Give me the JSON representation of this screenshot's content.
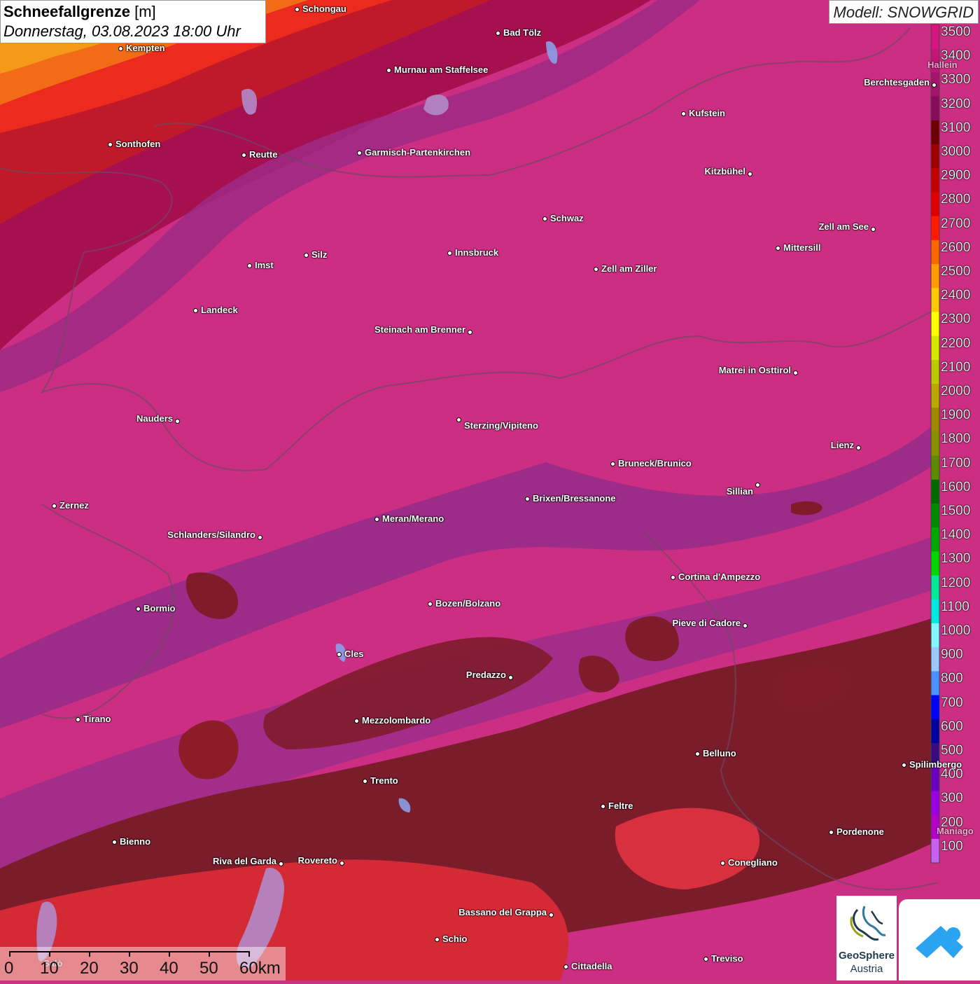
{
  "title": {
    "main": "Schneefallgrenze",
    "unit": "[m]",
    "date": "Donnerstag, 03.08.2023 18:00 Uhr"
  },
  "model": "Modell: SNOWGRID",
  "legend": [
    {
      "label": "3500",
      "color": "#d8127f"
    },
    {
      "label": "3400",
      "color": "#c41478"
    },
    {
      "label": "3300",
      "color": "#a8126e"
    },
    {
      "label": "3200",
      "color": "#8a0a5e"
    },
    {
      "label": "3100",
      "color": "#6e0000"
    },
    {
      "label": "3000",
      "color": "#a00000"
    },
    {
      "label": "2900",
      "color": "#c40000"
    },
    {
      "label": "2800",
      "color": "#e00000"
    },
    {
      "label": "2700",
      "color": "#ff1a00"
    },
    {
      "label": "2600",
      "color": "#ff6600"
    },
    {
      "label": "2500",
      "color": "#ff9a00"
    },
    {
      "label": "2400",
      "color": "#ffc800"
    },
    {
      "label": "2300",
      "color": "#ffff00"
    },
    {
      "label": "2200",
      "color": "#d8e800"
    },
    {
      "label": "2100",
      "color": "#c0c800"
    },
    {
      "label": "2000",
      "color": "#b8a800"
    },
    {
      "label": "1900",
      "color": "#a08800"
    },
    {
      "label": "1800",
      "color": "#889000"
    },
    {
      "label": "1700",
      "color": "#5c8a00"
    },
    {
      "label": "1600",
      "color": "#006a00"
    },
    {
      "label": "1500",
      "color": "#008a00"
    },
    {
      "label": "1400",
      "color": "#00a800"
    },
    {
      "label": "1300",
      "color": "#00d800"
    },
    {
      "label": "1200",
      "color": "#00e89a"
    },
    {
      "label": "1100",
      "color": "#00e8e0"
    },
    {
      "label": "1000",
      "color": "#80f8ff"
    },
    {
      "label": "900",
      "color": "#9ac8ff"
    },
    {
      "label": "800",
      "color": "#4a90ff"
    },
    {
      "label": "700",
      "color": "#0000ff"
    },
    {
      "label": "600",
      "color": "#0000a0"
    },
    {
      "label": "500",
      "color": "#3a0a80"
    },
    {
      "label": "400",
      "color": "#6a00c0"
    },
    {
      "label": "300",
      "color": "#9a00e0"
    },
    {
      "label": "200",
      "color": "#b400c8"
    },
    {
      "label": "100",
      "color": "#c860f0"
    }
  ],
  "cities": [
    {
      "name": "Schongau"
    },
    {
      "name": "Kempten"
    },
    {
      "name": "Bad Tölz"
    },
    {
      "name": "Murnau am Staffelsee"
    },
    {
      "name": "Berchtesgaden"
    },
    {
      "name": "Kufstein"
    },
    {
      "name": "Sonthofen"
    },
    {
      "name": "Reutte"
    },
    {
      "name": "Garmisch-Partenkirchen"
    },
    {
      "name": "Kitzbühel"
    },
    {
      "name": "Schwaz"
    },
    {
      "name": "Zell am See"
    },
    {
      "name": "Mittersill"
    },
    {
      "name": "Innsbruck"
    },
    {
      "name": "Imst"
    },
    {
      "name": "Silz"
    },
    {
      "name": "Zell am Ziller"
    },
    {
      "name": "Landeck"
    },
    {
      "name": "Steinach am Brenner"
    },
    {
      "name": "Matrei in Osttirol"
    },
    {
      "name": "Nauders"
    },
    {
      "name": "Sterzing/Vipiteno"
    },
    {
      "name": "Lienz"
    },
    {
      "name": "Bruneck/Brunico"
    },
    {
      "name": "Sillian"
    },
    {
      "name": "Zernez"
    },
    {
      "name": "Brixen/Bressanone"
    },
    {
      "name": "Meran/Merano"
    },
    {
      "name": "Schlanders/Silandro"
    },
    {
      "name": "Cortina d'Ampezzo"
    },
    {
      "name": "Bormio"
    },
    {
      "name": "Bozen/Bolzano"
    },
    {
      "name": "Pieve di Cadore"
    },
    {
      "name": "Cles"
    },
    {
      "name": "Predazzo"
    },
    {
      "name": "Tirano"
    },
    {
      "name": "Mezzolombardo"
    },
    {
      "name": "Belluno"
    },
    {
      "name": "Trento"
    },
    {
      "name": "Feltre"
    },
    {
      "name": "Pordenone"
    },
    {
      "name": "Bienno"
    },
    {
      "name": "Riva del Garda"
    },
    {
      "name": "Rovereto"
    },
    {
      "name": "Conegliano"
    },
    {
      "name": "Bassano del Grappa"
    },
    {
      "name": "Schio"
    },
    {
      "name": "Treviso"
    },
    {
      "name": "Cittadella"
    },
    {
      "name": "Spilimbergo"
    }
  ],
  "partial_labels": {
    "hallein": "Hallein",
    "maniago": "Maniago",
    "salo": "Salò"
  },
  "scale": {
    "ticks": [
      "0",
      "10",
      "20",
      "30",
      "40",
      "50",
      "60km"
    ]
  },
  "logo": {
    "line1": "GeoSphere",
    "line2": "Austria"
  }
}
